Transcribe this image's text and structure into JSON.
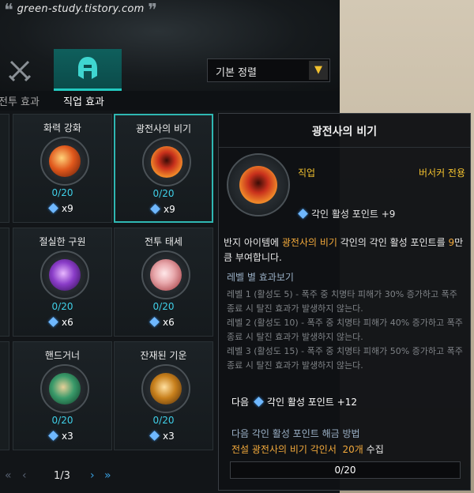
{
  "watermark": "green-study.tistory.com",
  "tabs": {
    "swords_icon": "crossed-swords-icon",
    "class_icon": "helmet-icon"
  },
  "sort": {
    "selected": "기본 정렬"
  },
  "subtabs": {
    "battle": "전투 효과",
    "class": "직업 효과"
  },
  "cards": [
    {
      "title": "화력 강화",
      "count": "0/20",
      "cost": "x9",
      "color": "#e0581c"
    },
    {
      "title": "광전사의 비기",
      "count": "0/20",
      "cost": "x9",
      "color": "#c8301c"
    },
    {
      "title": "절실한 구원",
      "count": "0/20",
      "cost": "x6",
      "color": "#8a3cc8"
    },
    {
      "title": "전투 태세",
      "count": "0/20",
      "cost": "x6",
      "color": "#e8a8ac"
    },
    {
      "title": "핸드거너",
      "count": "0/20",
      "cost": "x3",
      "color": "#3a9a6a"
    },
    {
      "title": "잔재된 기운",
      "count": "0/20",
      "cost": "x3",
      "color": "#c8801c"
    }
  ],
  "pager": {
    "first": "«",
    "prev": "‹",
    "page": "1/3",
    "next": "›",
    "last": "»"
  },
  "tooltip": {
    "title": "광전사의 비기",
    "class_label": "직업",
    "restriction": "버서커 전용",
    "point": "각인 활성 포인트 +9",
    "desc_1": "반지 아이템에 ",
    "desc_name": "광전사의 비기",
    "desc_2": " 각인의 각인 활성 포인트를 ",
    "desc_num": "9",
    "desc_3": "만큼 부여합니다.",
    "levels_head": "레벨 별 효과보기",
    "levels": [
      "레벨 1 (활성도 5) - 폭주 중 치명타 피해가 30% 증가하고 폭주 종료 시 탈진 효과가 발생하지 않는다.",
      "레벨 2 (활성도 10) - 폭주 중 치명타 피해가 40% 증가하고 폭주 종료 시 탈진 효과가 발생하지 않는다.",
      "레벨 3 (활성도 15) - 폭주 중 치명타 피해가 50% 증가하고 폭주 종료 시 탈진 효과가 발생하지 않는다."
    ],
    "next_label": "다음",
    "next_point": "각인 활성 포인트 +12",
    "method": "다음 각인 활성 포인트 해금 방법",
    "req_item": "전설 광전사의 비기 각인서",
    "req_qty": "20개",
    "req_verb": "수집",
    "progress": "0/20",
    "progress_value": 0
  }
}
